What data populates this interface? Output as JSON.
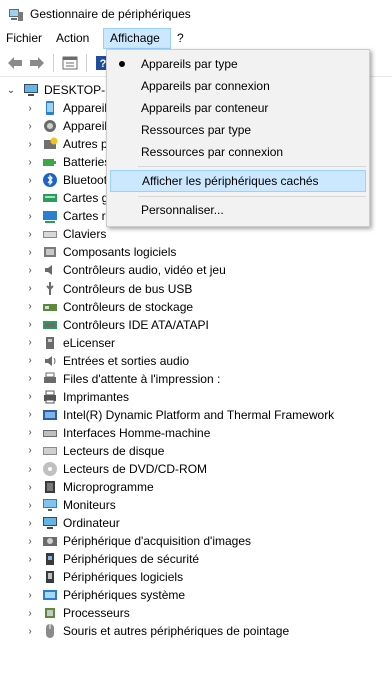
{
  "window": {
    "title": "Gestionnaire de périphériques",
    "icon": "device-manager-icon"
  },
  "menubar": {
    "items": [
      {
        "label": "Fichier"
      },
      {
        "label": "Action"
      },
      {
        "label": "Affichage"
      },
      {
        "label": "?"
      }
    ]
  },
  "toolbar": {
    "buttons": [
      "back-arrow-icon",
      "forward-arrow-icon",
      "properties-icon",
      "help-icon"
    ]
  },
  "tree": {
    "root": {
      "label": "DESKTOP-M",
      "icon": "computer-icon"
    },
    "items": [
      {
        "label": "Appareils",
        "icon": "phone-icon"
      },
      {
        "label": "Appareils",
        "icon": "camera-icon"
      },
      {
        "label": "Autres p",
        "icon": "unknown-device-icon"
      },
      {
        "label": "Batteries",
        "icon": "battery-icon"
      },
      {
        "label": "Bluetooth",
        "icon": "bluetooth-icon"
      },
      {
        "label": "Cartes g",
        "icon": "display-adapter-icon"
      },
      {
        "label": "Cartes r",
        "icon": "network-adapter-icon"
      },
      {
        "label": "Claviers",
        "icon": "keyboard-icon"
      },
      {
        "label": "Composants logiciels",
        "icon": "software-component-icon"
      },
      {
        "label": "Contrôleurs audio, vidéo et jeu",
        "icon": "speaker-icon"
      },
      {
        "label": "Contrôleurs de bus USB",
        "icon": "usb-icon"
      },
      {
        "label": "Contrôleurs de stockage",
        "icon": "storage-controller-icon"
      },
      {
        "label": "Contrôleurs IDE ATA/ATAPI",
        "icon": "ide-controller-icon"
      },
      {
        "label": "eLicenser",
        "icon": "elicenser-icon"
      },
      {
        "label": "Entrées et sorties audio",
        "icon": "audio-io-icon"
      },
      {
        "label": "Files d'attente à l'impression :",
        "icon": "print-queue-icon"
      },
      {
        "label": "Imprimantes",
        "icon": "printer-icon"
      },
      {
        "label": "Intel(R) Dynamic Platform and Thermal Framework",
        "icon": "thermal-framework-icon"
      },
      {
        "label": "Interfaces Homme-machine",
        "icon": "hid-icon"
      },
      {
        "label": "Lecteurs de disque",
        "icon": "disk-drive-icon"
      },
      {
        "label": "Lecteurs de DVD/CD-ROM",
        "icon": "dvd-drive-icon"
      },
      {
        "label": "Microprogramme",
        "icon": "firmware-icon"
      },
      {
        "label": "Moniteurs",
        "icon": "monitor-icon"
      },
      {
        "label": "Ordinateur",
        "icon": "computer-icon"
      },
      {
        "label": "Périphérique d'acquisition d'images",
        "icon": "imaging-device-icon"
      },
      {
        "label": "Périphériques de sécurité",
        "icon": "security-device-icon"
      },
      {
        "label": "Périphériques logiciels",
        "icon": "software-device-icon"
      },
      {
        "label": "Périphériques système",
        "icon": "system-device-icon"
      },
      {
        "label": "Processeurs",
        "icon": "processor-icon"
      },
      {
        "label": "Souris et autres périphériques de pointage",
        "icon": "mouse-icon"
      }
    ]
  },
  "dropdown": {
    "items": [
      {
        "label": "Appareils par type",
        "checked": true
      },
      {
        "label": "Appareils par connexion"
      },
      {
        "label": "Appareils par conteneur"
      },
      {
        "label": "Ressources par type"
      },
      {
        "label": "Ressources par connexion"
      },
      {
        "label": "Afficher les périphériques cachés",
        "highlighted": true
      },
      {
        "label": "Personnaliser..."
      }
    ]
  },
  "colors": {
    "highlight_bg": "#cce8ff",
    "highlight_border": "#99d1ff",
    "menu_bg": "#f2f2f2"
  }
}
